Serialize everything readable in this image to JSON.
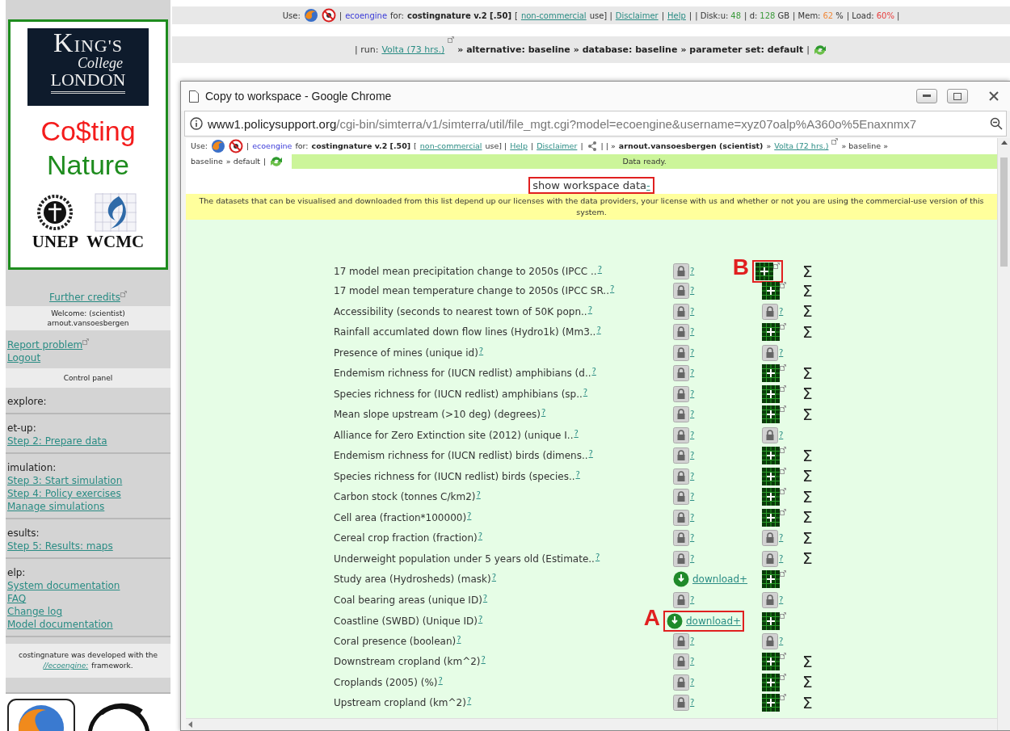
{
  "top_bar": {
    "segments": [
      {
        "kind": "text",
        "text": "Use:"
      },
      {
        "kind": "browser"
      },
      {
        "kind": "noentry"
      },
      {
        "kind": "text",
        "text": "|"
      },
      {
        "kind": "brand",
        "text": "ecoengine"
      },
      {
        "kind": "text",
        "text": "for:"
      },
      {
        "kind": "bold",
        "text": "costingnature v.2 [.50]"
      },
      {
        "kind": "text",
        "text": "["
      },
      {
        "kind": "link",
        "text": "non-commercial"
      },
      {
        "kind": "text",
        "text": "use] |"
      },
      {
        "kind": "link",
        "text": "Disclaimer"
      },
      {
        "kind": "text",
        "text": "|"
      },
      {
        "kind": "link",
        "text": "Help"
      },
      {
        "kind": "text",
        "text": "|"
      },
      {
        "kind": "stat",
        "label": "| Disk:u:",
        "value": "48",
        "color": "#3c9a3c"
      },
      {
        "kind": "stat",
        "label": "| d:",
        "value": "128",
        "unit": "GB",
        "color": "#3c9a3c"
      },
      {
        "kind": "stat",
        "label": "| Mem:",
        "value": "62",
        "unit": "%",
        "color": "#f08a3c"
      },
      {
        "kind": "stat",
        "label": "| Load:",
        "value": "60%",
        "unit": "|",
        "color": "#e83c3c"
      }
    ]
  },
  "run_bar": {
    "segments": [
      {
        "kind": "text",
        "text": "| run:"
      },
      {
        "kind": "link",
        "text": "Volta (73 hrs.)"
      },
      {
        "kind": "extlink"
      },
      {
        "kind": "bold",
        "text": "» alternative: baseline"
      },
      {
        "kind": "bold",
        "text": "» database: baseline"
      },
      {
        "kind": "bold",
        "text": "» parameter set: default"
      },
      {
        "kind": "text",
        "text": "|"
      },
      {
        "kind": "refresh"
      }
    ]
  },
  "sidebar": {
    "logo": {
      "name_line1": "KING'S",
      "name_line2": "College",
      "name_line3": "LONDON"
    },
    "app_title_line1": "Co$ting",
    "app_title_line2": "Nature",
    "partners": [
      "UNEP",
      "WCMC"
    ],
    "credits_link": "Further credits",
    "welcome": [
      "Welcome: (scientist)",
      "arnout.vansoesbergen"
    ],
    "account_links": [
      {
        "text": "Report problem",
        "external": true
      },
      {
        "text": "Logout",
        "external": false
      }
    ],
    "control_panel": "Control panel",
    "sections": [
      {
        "heading": "explore:"
      },
      {
        "heading": "et-up:",
        "links": [
          "Step 2: Prepare data"
        ]
      },
      {
        "heading": "imulation:",
        "links": [
          "Step 3: Start simulation",
          "Step 4: Policy exercises",
          "Manage simulations"
        ]
      },
      {
        "heading": "esults:",
        "links": [
          "Step 5: Results: maps"
        ]
      },
      {
        "heading": "elp:",
        "links": [
          "System documentation",
          "FAQ",
          "Change log",
          "Model documentation"
        ]
      }
    ],
    "footer_text": "costingnature was developed with the",
    "footer_link": "//ecoengine:",
    "footer_end": "framework."
  },
  "popup": {
    "title": "Copy to workspace - Google Chrome",
    "url_host": "www1.policysupport.org",
    "url_path": "/cgi-bin/simterra/v1/simterra/util/file_mgt.cgi?model=ecoengine&username=xyz07oalp%A360o%5Enaxnmx7",
    "toolbar_lines": [
      [
        {
          "kind": "text",
          "text": "Use:"
        },
        {
          "kind": "browser"
        },
        {
          "kind": "noentry"
        },
        {
          "kind": "text",
          "text": "|"
        },
        {
          "kind": "brand",
          "text": "ecoengine"
        },
        {
          "kind": "text",
          "text": "for:"
        },
        {
          "kind": "bold",
          "text": "costingnature v.2 [.50]"
        },
        {
          "kind": "text",
          "text": "["
        },
        {
          "kind": "link",
          "text": "non-commercial"
        },
        {
          "kind": "text",
          "text": "use] |"
        },
        {
          "kind": "link",
          "text": "Help"
        },
        {
          "kind": "text",
          "text": "|"
        },
        {
          "kind": "link",
          "text": "Disclaimer"
        },
        {
          "kind": "text",
          "text": "|"
        },
        {
          "kind": "share"
        },
        {
          "kind": "text",
          "text": "| | »"
        },
        {
          "kind": "bold",
          "text": "arnout.vansoesbergen (scientist)"
        },
        {
          "kind": "text",
          "text": "»"
        },
        {
          "kind": "link",
          "text": "Volta (72 hrs.)"
        },
        {
          "kind": "extlink"
        },
        {
          "kind": "text",
          "text": "» baseline »"
        }
      ],
      [
        {
          "kind": "text",
          "text": "baseline"
        },
        {
          "kind": "text",
          "text": "» default"
        },
        {
          "kind": "text",
          "text": "|"
        },
        {
          "kind": "refresh"
        }
      ]
    ],
    "status": "Data ready.",
    "heading": {
      "text": "show workspace data",
      "link": "-",
      "highlighted": true
    },
    "note": "The datasets that can be visualised and downloaded from this list depend up our licenses with the data providers, your license with us and whether or not you are using the commercial-use version of this system.",
    "rows": [
      {
        "label": "17 model mean precipitation change to 2050s (IPCC ..",
        "help": "?",
        "access": {
          "kind": "lock",
          "help": "?"
        },
        "view": {
          "kind": "map",
          "callout": "B"
        },
        "sum": "Σ"
      },
      {
        "label": "17 model mean temperature change to 2050s (IPCC SR..",
        "help": "?",
        "access": {
          "kind": "lock",
          "help": "?"
        },
        "view": {
          "kind": "map"
        },
        "sum": "Σ"
      },
      {
        "label": "Accessibility (seconds to nearest town of 50K popn..",
        "help": "?",
        "access": {
          "kind": "lock",
          "help": "?"
        },
        "view": {
          "kind": "lock",
          "help": "?"
        },
        "sum": "Σ"
      },
      {
        "label": "Rainfall accumlated down flow lines (Hydro1k) (Mm3..",
        "help": "?",
        "access": {
          "kind": "lock",
          "help": "?"
        },
        "view": {
          "kind": "map"
        },
        "sum": "Σ"
      },
      {
        "label": "Presence of mines (unique id)",
        "help": "?",
        "access": {
          "kind": "lock",
          "help": "?"
        },
        "view": {
          "kind": "lock",
          "help": "?"
        }
      },
      {
        "label": "Endemism richness for (IUCN redlist) amphibians (d..",
        "help": "?",
        "access": {
          "kind": "lock",
          "help": "?"
        },
        "view": {
          "kind": "map"
        },
        "sum": "Σ"
      },
      {
        "label": "Species richness for (IUCN redlist) amphibians (sp..",
        "help": "?",
        "access": {
          "kind": "lock",
          "help": "?"
        },
        "view": {
          "kind": "map"
        },
        "sum": "Σ"
      },
      {
        "label": "Mean slope upstream (>10 deg) (degrees)",
        "help": "?",
        "access": {
          "kind": "lock",
          "help": "?"
        },
        "view": {
          "kind": "map"
        },
        "sum": "Σ"
      },
      {
        "label": "Alliance for Zero Extinction site (2012) (unique I..",
        "help": "?",
        "access": {
          "kind": "lock",
          "help": "?"
        },
        "view": {
          "kind": "lock",
          "help": "?"
        }
      },
      {
        "label": "Endemism richness for (IUCN redlist) birds (dimens..",
        "help": "?",
        "access": {
          "kind": "lock",
          "help": "?"
        },
        "view": {
          "kind": "map"
        },
        "sum": "Σ"
      },
      {
        "label": "Species richness for (IUCN redlist) birds (species..",
        "help": "?",
        "access": {
          "kind": "lock",
          "help": "?"
        },
        "view": {
          "kind": "map"
        },
        "sum": "Σ"
      },
      {
        "label": "Carbon stock (tonnes C/km2)",
        "help": "?",
        "access": {
          "kind": "lock",
          "help": "?"
        },
        "view": {
          "kind": "map"
        },
        "sum": "Σ"
      },
      {
        "label": "Cell area (fraction*100000)",
        "help": "?",
        "access": {
          "kind": "lock",
          "help": "?"
        },
        "view": {
          "kind": "map"
        },
        "sum": "Σ"
      },
      {
        "label": "Cereal crop fraction (fraction)",
        "help": "?",
        "access": {
          "kind": "lock",
          "help": "?"
        },
        "view": {
          "kind": "lock",
          "help": "?"
        },
        "sum": "Σ"
      },
      {
        "label": "Underweight population under 5 years old (Estimate..",
        "help": "?",
        "access": {
          "kind": "lock",
          "help": "?"
        },
        "view": {
          "kind": "lock",
          "help": "?"
        },
        "sum": "Σ"
      },
      {
        "label": "Study area (Hydrosheds) (mask)",
        "help": "?",
        "access": {
          "kind": "download",
          "text": "download+"
        },
        "view": {
          "kind": "map"
        }
      },
      {
        "label": "Coal bearing areas (unique ID)",
        "help": "?",
        "access": {
          "kind": "lock",
          "help": "?"
        },
        "view": {
          "kind": "lock",
          "help": "?"
        }
      },
      {
        "label": "Coastline (SWBD) (Unique ID)",
        "help": "?",
        "access": {
          "kind": "download",
          "text": "download+",
          "callout": "A"
        },
        "view": {
          "kind": "map"
        }
      },
      {
        "label": "Coral presence (boolean)",
        "help": "?",
        "access": {
          "kind": "lock",
          "help": "?"
        },
        "view": {
          "kind": "lock",
          "help": "?"
        }
      },
      {
        "label": "Downstream cropland (km^2)",
        "help": "?",
        "access": {
          "kind": "lock",
          "help": "?"
        },
        "view": {
          "kind": "map"
        },
        "sum": "Σ"
      },
      {
        "label": "Croplands (2005) (%)",
        "help": "?",
        "access": {
          "kind": "lock",
          "help": "?"
        },
        "view": {
          "kind": "map"
        },
        "sum": "Σ"
      },
      {
        "label": "Upstream cropland (km^2)",
        "help": "?",
        "access": {
          "kind": "lock",
          "help": "?"
        },
        "view": {
          "kind": "map"
        },
        "sum": "Σ"
      }
    ]
  }
}
